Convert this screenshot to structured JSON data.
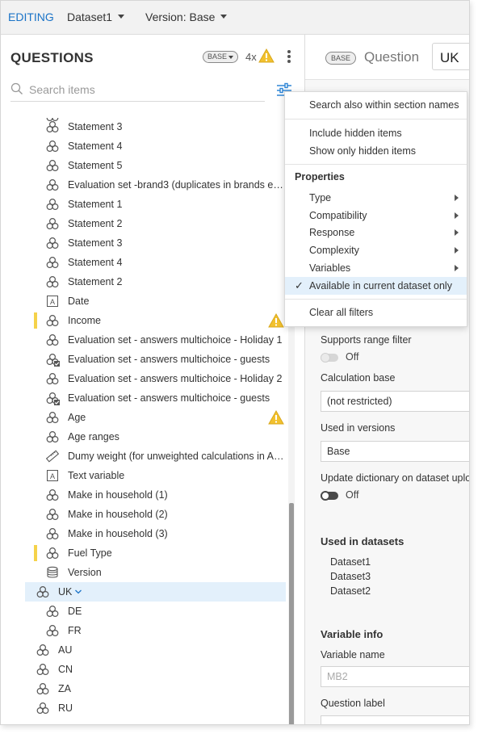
{
  "topbar": {
    "mode": "EDITING",
    "dataset": "Dataset1",
    "version": "Version: Base"
  },
  "left": {
    "title": "QUESTIONS",
    "base_badge": "BASE",
    "warning_count": "4x",
    "search_placeholder": "Search items",
    "tree": [
      {
        "label": "Statement 3",
        "icon": "cluster-icon",
        "indent": 1
      },
      {
        "label": "Statement 4",
        "icon": "cluster-icon",
        "indent": 1
      },
      {
        "label": "Statement 5",
        "icon": "cluster-icon",
        "indent": 1
      },
      {
        "label": "Evaluation set -brand3 (duplicates in brands e…",
        "icon": "cluster-icon",
        "indent": 1
      },
      {
        "label": "Statement 1",
        "icon": "cluster-icon",
        "indent": 1
      },
      {
        "label": "Statement 2",
        "icon": "cluster-icon",
        "indent": 1
      },
      {
        "label": "Statement 3",
        "icon": "cluster-icon",
        "indent": 1
      },
      {
        "label": "Statement 4",
        "icon": "cluster-icon",
        "indent": 1
      },
      {
        "label": "Statement 2",
        "icon": "cluster-icon",
        "indent": 1
      },
      {
        "label": "Date",
        "icon": "text-icon",
        "indent": 1
      },
      {
        "label": "Income",
        "icon": "cluster-icon",
        "indent": 1,
        "flag": true,
        "warn": true
      },
      {
        "label": "Evaluation set - answers multichoice - Holiday 1",
        "icon": "cluster-icon",
        "indent": 1
      },
      {
        "label": "Evaluation set - answers multichoice - guests",
        "icon": "cluster-check-icon",
        "indent": 1
      },
      {
        "label": "Evaluation set - answers multichoice - Holiday 2",
        "icon": "cluster-icon",
        "indent": 1
      },
      {
        "label": "Evaluation set - answers multichoice - guests",
        "icon": "cluster-check-icon",
        "indent": 1
      },
      {
        "label": "Age",
        "icon": "cluster-icon",
        "indent": 1,
        "warn": true
      },
      {
        "label": "Age ranges",
        "icon": "cluster-icon",
        "indent": 1
      },
      {
        "label": "Dumy weight (for unweighted calculations in A…",
        "icon": "ruler-icon",
        "indent": 1
      },
      {
        "label": "Text variable",
        "icon": "text-icon",
        "indent": 1
      },
      {
        "label": "Make in household (1)",
        "icon": "cluster-icon",
        "indent": 1
      },
      {
        "label": "Make in household (2)",
        "icon": "cluster-icon",
        "indent": 1
      },
      {
        "label": "Make in household (3)",
        "icon": "cluster-icon",
        "indent": 1
      },
      {
        "label": "Fuel Type",
        "icon": "cluster-icon",
        "indent": 1,
        "flag": true
      },
      {
        "label": "Version",
        "icon": "database-icon",
        "indent": 1
      },
      {
        "label": "UK",
        "icon": "cluster-icon",
        "indent": 0,
        "selected": true,
        "expand": true
      },
      {
        "label": "DE",
        "icon": "cluster-icon",
        "indent": 1
      },
      {
        "label": "FR",
        "icon": "cluster-icon",
        "indent": 1
      },
      {
        "label": "AU",
        "icon": "cluster-icon",
        "indent": -1
      },
      {
        "label": "CN",
        "icon": "cluster-icon",
        "indent": -1
      },
      {
        "label": "ZA",
        "icon": "cluster-icon",
        "indent": -1
      },
      {
        "label": "RU",
        "icon": "cluster-icon",
        "indent": -1
      }
    ]
  },
  "right": {
    "base_badge": "BASE",
    "heading": "Question",
    "name_value": "UK",
    "supports_range_label": "Supports range filter",
    "supports_range_state": "Off",
    "calc_base_label": "Calculation base",
    "calc_base_value": "(not restricted)",
    "used_in_versions_label": "Used in versions",
    "used_in_versions_value": "Base",
    "update_dict_label": "Update dictionary on dataset upload",
    "update_dict_state": "Off",
    "used_in_datasets_title": "Used in datasets",
    "datasets": [
      "Dataset1",
      "Dataset3",
      "Dataset2"
    ],
    "variable_info_title": "Variable info",
    "variable_name_label": "Variable name",
    "variable_name_value": "MB2",
    "question_label_label": "Question label"
  },
  "dropdown": {
    "search_sections": "Search also within section names",
    "include_hidden": "Include hidden items",
    "show_only_hidden": "Show only hidden items",
    "properties_header": "Properties",
    "submenus": [
      "Type",
      "Compatibility",
      "Response",
      "Complexity",
      "Variables"
    ],
    "available_only": "Available in current dataset only",
    "available_only_checked": true,
    "clear_filters": "Clear all filters"
  },
  "colors": {
    "accent": "#1a73c7",
    "selection": "#e3f0fb",
    "flag": "#f5d24a",
    "warning": "#f2c12e"
  }
}
